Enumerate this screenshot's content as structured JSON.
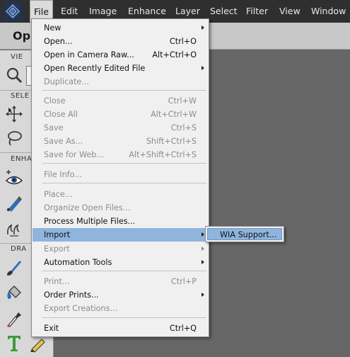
{
  "menubar": {
    "items": [
      "File",
      "Edit",
      "Image",
      "Enhance",
      "Layer",
      "Select",
      "Filter",
      "View",
      "Window"
    ],
    "active": "File"
  },
  "titlebar": {
    "title": "Op"
  },
  "toolpanel": {
    "sections": [
      "VIE",
      "SELE",
      "ENHA",
      "DRA"
    ],
    "tools": [
      "zoom-tool",
      "hand-tool",
      "move-tool",
      "lasso-tool",
      "red-eye-tool",
      "spot-healing-tool",
      "smart-brush-tool",
      "brush-tool",
      "paint-bucket-tool",
      "eyedropper-tool",
      "type-tool",
      "pencil-tool"
    ]
  },
  "file_menu": {
    "items": [
      {
        "label": "New",
        "shortcut": "",
        "submenu": true,
        "enabled": true
      },
      {
        "label": "Open...",
        "shortcut": "Ctrl+O",
        "submenu": false,
        "enabled": true
      },
      {
        "label": "Open in Camera Raw...",
        "shortcut": "Alt+Ctrl+O",
        "submenu": false,
        "enabled": true
      },
      {
        "label": "Open Recently Edited File",
        "shortcut": "",
        "submenu": true,
        "enabled": true
      },
      {
        "label": "Duplicate...",
        "shortcut": "",
        "submenu": false,
        "enabled": false
      },
      {
        "label": "Close",
        "shortcut": "Ctrl+W",
        "submenu": false,
        "enabled": false
      },
      {
        "label": "Close All",
        "shortcut": "Alt+Ctrl+W",
        "submenu": false,
        "enabled": false
      },
      {
        "label": "Save",
        "shortcut": "Ctrl+S",
        "submenu": false,
        "enabled": false
      },
      {
        "label": "Save As...",
        "shortcut": "Shift+Ctrl+S",
        "submenu": false,
        "enabled": false
      },
      {
        "label": "Save for Web...",
        "shortcut": "Alt+Shift+Ctrl+S",
        "submenu": false,
        "enabled": false
      },
      {
        "label": "File Info...",
        "shortcut": "",
        "submenu": false,
        "enabled": false
      },
      {
        "label": "Place...",
        "shortcut": "",
        "submenu": false,
        "enabled": false
      },
      {
        "label": "Organize Open Files...",
        "shortcut": "",
        "submenu": false,
        "enabled": false
      },
      {
        "label": "Process Multiple Files...",
        "shortcut": "",
        "submenu": false,
        "enabled": true
      },
      {
        "label": "Import",
        "shortcut": "",
        "submenu": true,
        "enabled": true
      },
      {
        "label": "Export",
        "shortcut": "",
        "submenu": true,
        "enabled": false
      },
      {
        "label": "Automation Tools",
        "shortcut": "",
        "submenu": true,
        "enabled": true
      },
      {
        "label": "Print...",
        "shortcut": "Ctrl+P",
        "submenu": false,
        "enabled": false
      },
      {
        "label": "Order Prints...",
        "shortcut": "",
        "submenu": true,
        "enabled": true
      },
      {
        "label": "Export Creations...",
        "shortcut": "",
        "submenu": false,
        "enabled": false
      },
      {
        "label": "Exit",
        "shortcut": "Ctrl+Q",
        "submenu": false,
        "enabled": true
      }
    ],
    "highlighted": "Import"
  },
  "import_submenu": {
    "items": [
      "WIA Support..."
    ]
  },
  "colors": {
    "menubar_bg": "#2f2f2f",
    "highlight": "#8fb4dd",
    "canvas_bg": "#666666",
    "disabled_text": "#8c8c8c"
  }
}
